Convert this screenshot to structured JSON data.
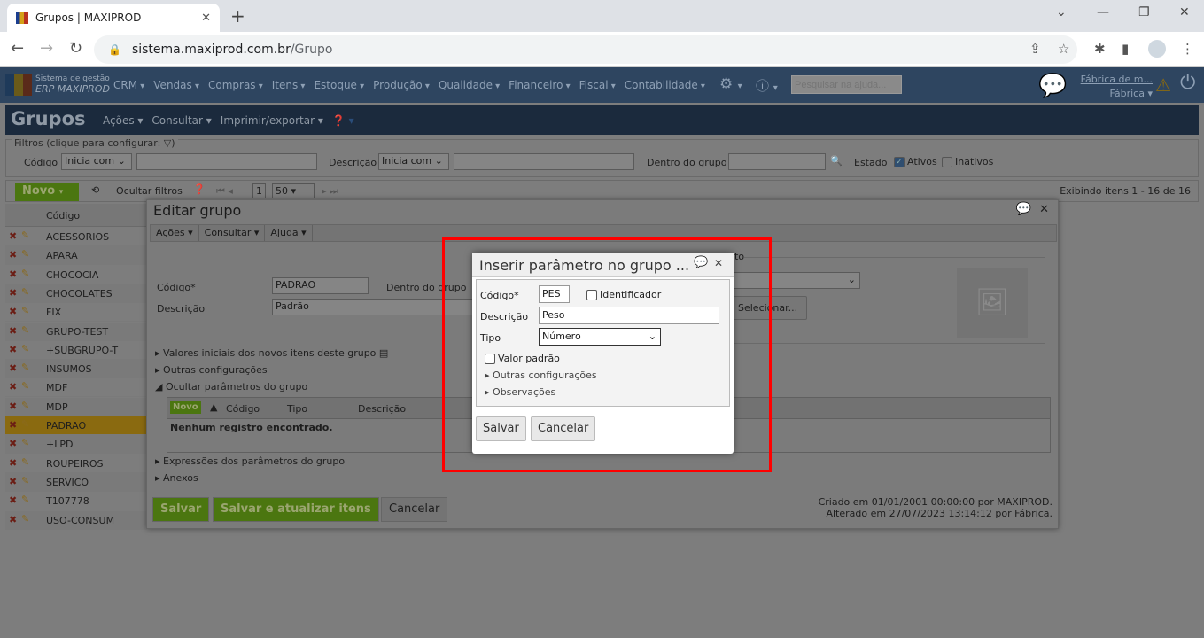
{
  "browser": {
    "tab_title": "Grupos | MAXIPROD",
    "url_host": "sistema.maxiprod.com.br",
    "url_path": "/Grupo"
  },
  "app": {
    "logo_line1": "Sistema de gestão",
    "logo_line2": "ERP MAXIPROD",
    "menus": [
      "CRM",
      "Vendas",
      "Compras",
      "Itens",
      "Estoque",
      "Produção",
      "Qualidade",
      "Financeiro",
      "Fiscal",
      "Contabilidade"
    ],
    "help_search_placeholder": "Pesquisar na ajuda...",
    "user_name": "Fábrica de m...",
    "user_company": "Fábrica"
  },
  "page": {
    "title": "Grupos",
    "menus": [
      "Ações",
      "Consultar",
      "Imprimir/exportar"
    ]
  },
  "filters": {
    "legend": "Filtros (clique para configurar:",
    "codigo_label": "Código",
    "codigo_op": "Inicia com",
    "descricao_label": "Descrição",
    "descricao_op": "Inicia com",
    "grupo_label": "Dentro do grupo",
    "estado_label": "Estado",
    "ativos": "Ativos",
    "inativos": "Inativos"
  },
  "grid": {
    "novo": "Novo",
    "ocultar": "Ocultar filtros",
    "page": "1",
    "page_size": "50",
    "count": "Exibindo itens 1 - 16 de 16",
    "col_codigo": "Código",
    "rows": [
      "ACESSORIOS",
      "APARA",
      "CHOCOCIA",
      "CHOCOLATES",
      "FIX",
      "GRUPO-TEST",
      "+SUBGRUPO-T",
      "INSUMOS",
      "MDF",
      "MDP",
      "PADRAO",
      "+LPD",
      "ROUPEIROS",
      "SERVICO",
      "T107778",
      "USO-CONSUM"
    ]
  },
  "edit": {
    "title": "Editar grupo",
    "menus": [
      "Ações",
      "Consultar",
      "Ajuda"
    ],
    "codigo_label": "Código*",
    "codigo": "PADRAO",
    "grupo_label": "Dentro do grupo",
    "descricao_label": "Descrição",
    "descricao": "Padrão",
    "fieldset_tail": "to",
    "selecionar": "Selecionar...",
    "sections": [
      "Valores iniciais dos novos itens deste grupo",
      "Outras configurações",
      "Ocultar parâmetros do grupo"
    ],
    "params_cols": [
      "Novo",
      "Código",
      "Tipo",
      "Descrição"
    ],
    "params_empty": "Nenhum registro encontrado.",
    "sections2": [
      "Expressões dos parâmetros do grupo",
      "Anexos"
    ],
    "salvar": "Salvar",
    "salvar_atualizar": "Salvar e atualizar itens",
    "cancelar": "Cancelar",
    "criado": "Criado em 01/01/2001 00:00:00 por MAXIPROD.",
    "alterado": "Alterado em 27/07/2023 13:14:12 por Fábrica."
  },
  "dialog": {
    "title": "Inserir parâmetro no grupo ...",
    "codigo_label": "Código*",
    "codigo": "PES",
    "identificador": "Identificador",
    "descricao_label": "Descrição",
    "descricao": "Peso",
    "tipo_label": "Tipo",
    "tipo": "Número",
    "valor_padrao": "Valor padrão",
    "outras": "Outras configurações",
    "observacoes": "Observações",
    "salvar": "Salvar",
    "cancelar": "Cancelar"
  }
}
